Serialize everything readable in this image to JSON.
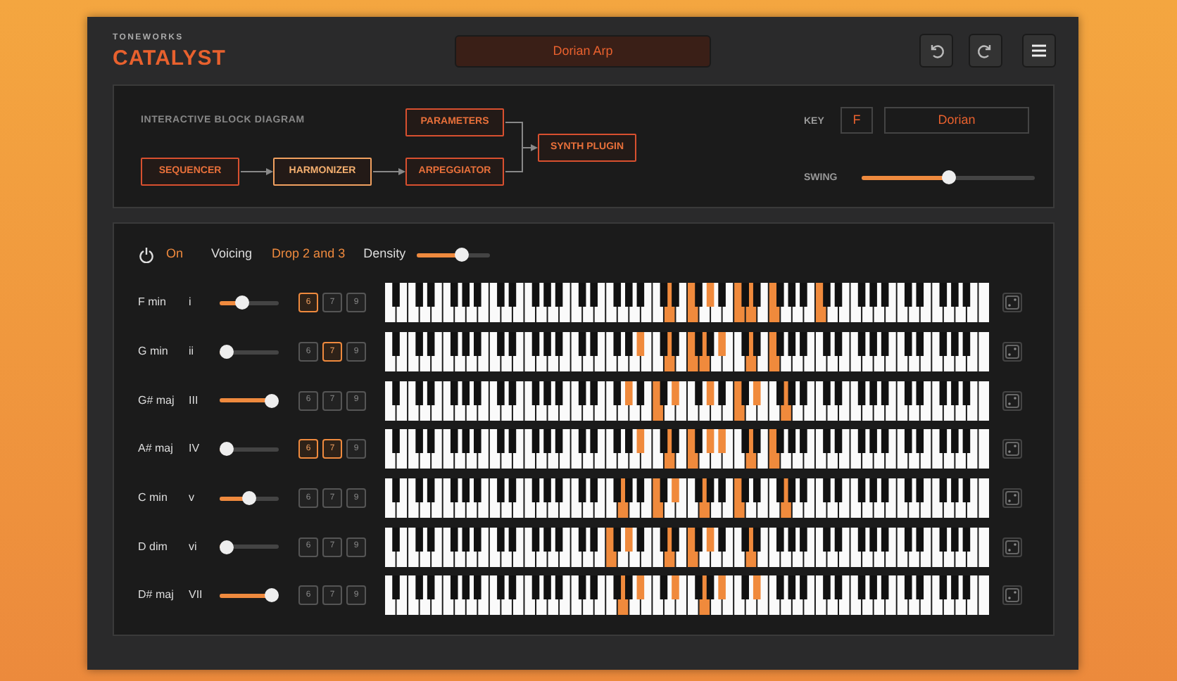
{
  "header": {
    "brand_small": "TONEWORKS",
    "brand": "CATALYST",
    "preset": "Dorian Arp",
    "buttons": [
      {
        "kind": "undo"
      },
      {
        "kind": "redo"
      },
      {
        "kind": "menu"
      }
    ]
  },
  "diagram": {
    "title": "INTERACTIVE BLOCK DIAGRAM",
    "blocks": [
      {
        "label": "PARAMETERS",
        "selected": false
      },
      {
        "label": "SYNTH PLUGIN",
        "selected": false
      },
      {
        "label": "SEQUENCER",
        "selected": false
      },
      {
        "label": "HARMONIZER",
        "selected": true
      },
      {
        "label": "ARPEGGIATOR",
        "selected": false
      }
    ],
    "key_label": "KEY",
    "key": "F",
    "mode": "Dorian",
    "swing_label": "SWING",
    "swing": {
      "level": 0.5
    }
  },
  "controls": {
    "power_on": true,
    "power_label": "On",
    "voicing_label": "Voicing",
    "voicing": "Drop 2 and 3",
    "density_label": "Density",
    "density": {
      "level": 0.65
    }
  },
  "chords": [
    {
      "name": "F min",
      "numeral": "i",
      "level": 0.35,
      "extensions": [
        {
          "label": "6",
          "selected": true
        },
        {
          "label": "7",
          "selected": false
        },
        {
          "label": "9",
          "selected": false
        }
      ],
      "keys_lit": [
        false,
        false,
        false,
        false,
        false,
        false,
        false,
        false,
        false,
        false,
        false,
        false,
        false,
        false,
        false,
        false,
        false,
        false,
        false,
        false,
        false,
        false,
        false,
        false,
        false,
        false,
        false,
        false,
        false,
        false,
        false,
        false,
        false,
        false,
        false,
        false,
        false,
        false,
        false,
        false,
        false,
        true,
        false,
        false,
        true,
        false,
        false,
        true,
        false,
        false,
        false,
        true,
        false,
        true,
        false,
        false,
        true,
        false,
        false,
        false,
        false,
        false,
        false,
        true,
        false,
        false,
        false,
        false,
        false,
        false,
        false,
        false,
        false,
        false,
        false,
        false,
        false,
        false,
        false,
        false,
        false,
        false,
        false,
        false,
        false,
        false,
        false,
        false
      ]
    },
    {
      "name": "G min",
      "numeral": "ii",
      "level": 0,
      "extensions": [
        {
          "label": "6",
          "selected": false
        },
        {
          "label": "7",
          "selected": true
        },
        {
          "label": "9",
          "selected": false
        }
      ],
      "keys_lit": [
        false,
        false,
        false,
        false,
        false,
        false,
        false,
        false,
        false,
        false,
        false,
        false,
        false,
        false,
        false,
        false,
        false,
        false,
        false,
        false,
        false,
        false,
        false,
        false,
        false,
        false,
        false,
        false,
        false,
        false,
        false,
        false,
        false,
        false,
        false,
        false,
        false,
        true,
        false,
        false,
        false,
        true,
        false,
        false,
        true,
        false,
        true,
        false,
        false,
        true,
        false,
        false,
        false,
        true,
        false,
        false,
        true,
        false,
        false,
        false,
        false,
        false,
        false,
        false,
        false,
        false,
        false,
        false,
        false,
        false,
        false,
        false,
        false,
        false,
        false,
        false,
        false,
        false,
        false,
        false,
        false,
        false,
        false,
        false,
        false,
        false,
        false,
        false
      ]
    },
    {
      "name": "G# maj",
      "numeral": "III",
      "level": 1,
      "extensions": [
        {
          "label": "6",
          "selected": false
        },
        {
          "label": "7",
          "selected": false
        },
        {
          "label": "9",
          "selected": false
        }
      ],
      "keys_lit": [
        false,
        false,
        false,
        false,
        false,
        false,
        false,
        false,
        false,
        false,
        false,
        false,
        false,
        false,
        false,
        false,
        false,
        false,
        false,
        false,
        false,
        false,
        false,
        false,
        false,
        false,
        false,
        false,
        false,
        false,
        false,
        false,
        false,
        false,
        false,
        true,
        false,
        false,
        false,
        true,
        false,
        false,
        true,
        false,
        false,
        false,
        false,
        true,
        false,
        false,
        false,
        true,
        false,
        false,
        true,
        false,
        false,
        false,
        true,
        false,
        false,
        false,
        false,
        false,
        false,
        false,
        false,
        false,
        false,
        false,
        false,
        false,
        false,
        false,
        false,
        false,
        false,
        false,
        false,
        false,
        false,
        false,
        false,
        false,
        false,
        false,
        false,
        false
      ]
    },
    {
      "name": "A# maj",
      "numeral": "IV",
      "level": 0,
      "extensions": [
        {
          "label": "6",
          "selected": true
        },
        {
          "label": "7",
          "selected": true
        },
        {
          "label": "9",
          "selected": false
        }
      ],
      "keys_lit": [
        false,
        false,
        false,
        false,
        false,
        false,
        false,
        false,
        false,
        false,
        false,
        false,
        false,
        false,
        false,
        false,
        false,
        false,
        false,
        false,
        false,
        false,
        false,
        false,
        false,
        false,
        false,
        false,
        false,
        false,
        false,
        false,
        false,
        false,
        false,
        false,
        false,
        true,
        false,
        false,
        false,
        true,
        false,
        false,
        true,
        false,
        false,
        true,
        false,
        true,
        false,
        false,
        false,
        true,
        false,
        false,
        true,
        false,
        false,
        false,
        false,
        false,
        false,
        false,
        false,
        false,
        false,
        false,
        false,
        false,
        false,
        false,
        false,
        false,
        false,
        false,
        false,
        false,
        false,
        false,
        false,
        false,
        false,
        false,
        false,
        false,
        false,
        false
      ]
    },
    {
      "name": "C min",
      "numeral": "v",
      "level": 0.5,
      "extensions": [
        {
          "label": "6",
          "selected": false
        },
        {
          "label": "7",
          "selected": false
        },
        {
          "label": "9",
          "selected": false
        }
      ],
      "keys_lit": [
        false,
        false,
        false,
        false,
        false,
        false,
        false,
        false,
        false,
        false,
        false,
        false,
        false,
        false,
        false,
        false,
        false,
        false,
        false,
        false,
        false,
        false,
        false,
        false,
        false,
        false,
        false,
        false,
        false,
        false,
        false,
        false,
        false,
        false,
        true,
        false,
        false,
        false,
        false,
        true,
        false,
        false,
        true,
        false,
        false,
        false,
        true,
        false,
        false,
        false,
        false,
        true,
        false,
        false,
        false,
        false,
        false,
        false,
        true,
        false,
        false,
        false,
        false,
        false,
        false,
        false,
        false,
        false,
        false,
        false,
        false,
        false,
        false,
        false,
        false,
        false,
        false,
        false,
        false,
        false,
        false,
        false,
        false,
        false,
        false,
        false,
        false,
        false
      ]
    },
    {
      "name": "D dim",
      "numeral": "vi",
      "level": 0,
      "extensions": [
        {
          "label": "6",
          "selected": false
        },
        {
          "label": "7",
          "selected": false
        },
        {
          "label": "9",
          "selected": false
        }
      ],
      "keys_lit": [
        false,
        false,
        false,
        false,
        false,
        false,
        false,
        false,
        false,
        false,
        false,
        false,
        false,
        false,
        false,
        false,
        false,
        false,
        false,
        false,
        false,
        false,
        false,
        false,
        false,
        false,
        false,
        false,
        false,
        false,
        false,
        false,
        true,
        false,
        false,
        true,
        false,
        false,
        false,
        false,
        false,
        true,
        false,
        false,
        true,
        false,
        false,
        true,
        false,
        false,
        false,
        false,
        false,
        true,
        false,
        false,
        false,
        false,
        false,
        false,
        false,
        false,
        false,
        false,
        false,
        false,
        false,
        false,
        false,
        false,
        false,
        false,
        false,
        false,
        false,
        false,
        false,
        false,
        false,
        false,
        false,
        false,
        false,
        false,
        false,
        false,
        false,
        false
      ]
    },
    {
      "name": "D# maj",
      "numeral": "VII",
      "level": 1,
      "extensions": [
        {
          "label": "6",
          "selected": false
        },
        {
          "label": "7",
          "selected": false
        },
        {
          "label": "9",
          "selected": false
        }
      ],
      "keys_lit": [
        false,
        false,
        false,
        false,
        false,
        false,
        false,
        false,
        false,
        false,
        false,
        false,
        false,
        false,
        false,
        false,
        false,
        false,
        false,
        false,
        false,
        false,
        false,
        false,
        false,
        false,
        false,
        false,
        false,
        false,
        false,
        false,
        false,
        false,
        true,
        false,
        false,
        true,
        false,
        false,
        false,
        false,
        true,
        false,
        false,
        false,
        true,
        false,
        false,
        true,
        false,
        false,
        false,
        false,
        true,
        false,
        false,
        false,
        false,
        false,
        false,
        false,
        false,
        false,
        false,
        false,
        false,
        false,
        false,
        false,
        false,
        false,
        false,
        false,
        false,
        false,
        false,
        false,
        false,
        false,
        false,
        false,
        false,
        false,
        false,
        false,
        false,
        false
      ]
    }
  ]
}
